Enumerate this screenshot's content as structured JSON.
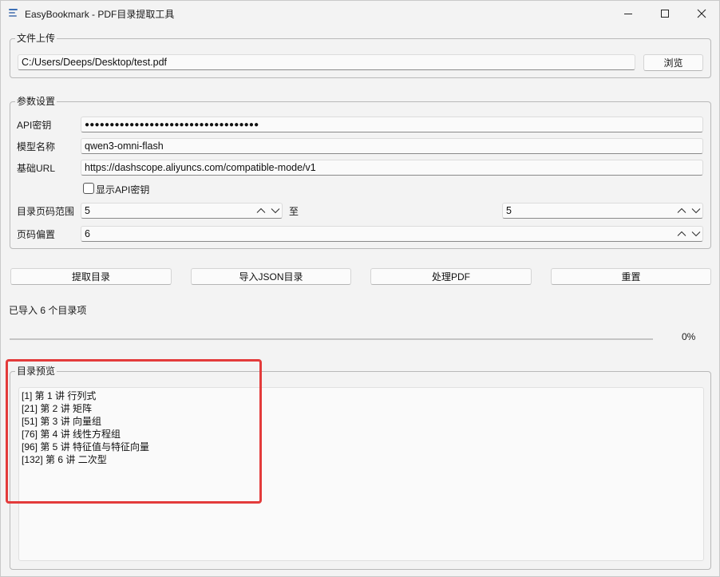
{
  "window": {
    "title": "EasyBookmark - PDF目录提取工具",
    "icon": "document-lines-icon"
  },
  "upload": {
    "group_title": "文件上传",
    "file_path": "C:/Users/Deeps/Desktop/test.pdf",
    "browse_label": "浏览"
  },
  "params": {
    "group_title": "参数设置",
    "api_key_label": "API密钥",
    "api_key_value": "●●●●●●●●●●●●●●●●●●●●●●●●●●●●●●●●●●●",
    "model_label": "模型名称",
    "model_value": "qwen3-omni-flash",
    "base_url_label": "基础URL",
    "base_url_value": "https://dashscope.aliyuncs.com/compatible-mode/v1",
    "show_key_label": "显示API密钥",
    "show_key_checked": false,
    "page_range_label": "目录页码范围",
    "page_from": "5",
    "to_label": "至",
    "page_to": "5",
    "offset_label": "页码偏置",
    "offset_value": "6"
  },
  "actions": {
    "extract_label": "提取目录",
    "import_json_label": "导入JSON目录",
    "process_pdf_label": "处理PDF",
    "reset_label": "重置"
  },
  "status": {
    "message": "已导入 6 个目录项",
    "progress_percent": 0,
    "progress_text": "0%"
  },
  "preview": {
    "group_title": "目录预览",
    "lines": [
      "[1] 第 1 讲 行列式",
      "[21] 第 2 讲 矩阵",
      "[51] 第 3 讲 向量组",
      "[76] 第 4 讲 线性方程组",
      "[96] 第 5 讲 特征值与特征向量",
      "[132] 第 6 讲 二次型"
    ]
  },
  "colors": {
    "accent": "#2a7ad6",
    "highlight": "#e33b3b"
  }
}
